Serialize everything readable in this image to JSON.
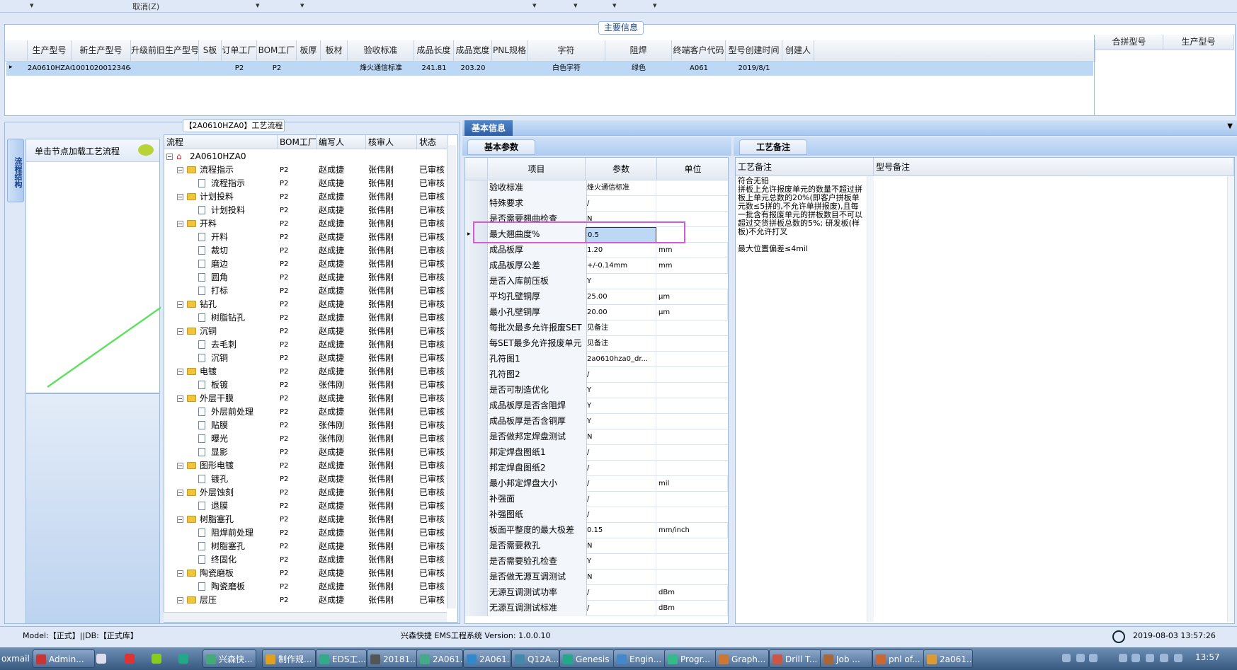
{
  "topbar": {
    "cancel": "取消(Z)"
  },
  "main_info": {
    "title": "主要信息",
    "columns": [
      "生产型号",
      "新生产型号",
      "升级前旧生产型号",
      "S板",
      "订单工厂",
      "BOM工厂",
      "板厚",
      "板材",
      "验收标准",
      "成品长度",
      "成品宽度",
      "PNL规格",
      "字符",
      "阻焊",
      "终端客户代码",
      "型号创建时间",
      "创建人"
    ],
    "right_columns": [
      "合拼型号",
      "生产型号"
    ],
    "row": {
      "生产型号": "2A0610HZA0",
      "新生产型号": "10010200123464",
      "订单工厂": "P2",
      "BOM工厂": "P2",
      "验收标准": "烽火通信标准",
      "成品长度": "241.81",
      "成品宽度": "203.20",
      "字符": "白色字符",
      "阻焊": "绿色",
      "终端客户代码": "A061",
      "型号创建时间": "2019/8/1"
    }
  },
  "left": {
    "tab_title": "【2A0610HZA0】工艺流程",
    "vtab": "流程结构",
    "nav_item": "单击节点加载工艺流程",
    "tree_headers": [
      "流程",
      "BOM工厂",
      "编写人",
      "核审人",
      "状态"
    ],
    "root": "2A0610HZA0",
    "rows": [
      {
        "name": "流程指示",
        "lvl": 1,
        "bom": "P2",
        "w": "赵成捷",
        "r": "张伟刚",
        "s": "已审核"
      },
      {
        "name": "流程指示",
        "lvl": 2,
        "bom": "P2",
        "w": "赵成捷",
        "r": "张伟刚",
        "s": "已审核"
      },
      {
        "name": "计划投料",
        "lvl": 1,
        "bom": "P2",
        "w": "赵成捷",
        "r": "张伟刚",
        "s": "已审核"
      },
      {
        "name": "计划投料",
        "lvl": 2,
        "bom": "P2",
        "w": "赵成捷",
        "r": "张伟刚",
        "s": "已审核"
      },
      {
        "name": "开料",
        "lvl": 1,
        "bom": "P2",
        "w": "赵成捷",
        "r": "张伟刚",
        "s": "已审核"
      },
      {
        "name": "开料",
        "lvl": 2,
        "bom": "P2",
        "w": "赵成捷",
        "r": "张伟刚",
        "s": "已审核"
      },
      {
        "name": "裁切",
        "lvl": 2,
        "bom": "P2",
        "w": "赵成捷",
        "r": "张伟刚",
        "s": "已审核"
      },
      {
        "name": "磨边",
        "lvl": 2,
        "bom": "P2",
        "w": "赵成捷",
        "r": "张伟刚",
        "s": "已审核"
      },
      {
        "name": "圆角",
        "lvl": 2,
        "bom": "P2",
        "w": "赵成捷",
        "r": "张伟刚",
        "s": "已审核"
      },
      {
        "name": "打标",
        "lvl": 2,
        "bom": "P2",
        "w": "赵成捷",
        "r": "张伟刚",
        "s": "已审核"
      },
      {
        "name": "钻孔",
        "lvl": 1,
        "bom": "P2",
        "w": "赵成捷",
        "r": "张伟刚",
        "s": "已审核"
      },
      {
        "name": "树脂钻孔",
        "lvl": 2,
        "bom": "P2",
        "w": "赵成捷",
        "r": "张伟刚",
        "s": "已审核"
      },
      {
        "name": "沉铜",
        "lvl": 1,
        "bom": "P2",
        "w": "赵成捷",
        "r": "张伟刚",
        "s": "已审核"
      },
      {
        "name": "去毛刺",
        "lvl": 2,
        "bom": "P2",
        "w": "赵成捷",
        "r": "张伟刚",
        "s": "已审核"
      },
      {
        "name": "沉铜",
        "lvl": 2,
        "bom": "P2",
        "w": "赵成捷",
        "r": "张伟刚",
        "s": "已审核"
      },
      {
        "name": "电镀",
        "lvl": 1,
        "bom": "P2",
        "w": "赵成捷",
        "r": "张伟刚",
        "s": "已审核"
      },
      {
        "name": "板镀",
        "lvl": 2,
        "bom": "P2",
        "w": "张伟刚",
        "r": "张伟刚",
        "s": "已审核"
      },
      {
        "name": "外层干膜",
        "lvl": 1,
        "bom": "P2",
        "w": "赵成捷",
        "r": "张伟刚",
        "s": "已审核"
      },
      {
        "name": "外层前处理",
        "lvl": 2,
        "bom": "P2",
        "w": "赵成捷",
        "r": "张伟刚",
        "s": "已审核"
      },
      {
        "name": "贴膜",
        "lvl": 2,
        "bom": "P2",
        "w": "张伟刚",
        "r": "张伟刚",
        "s": "已审核"
      },
      {
        "name": "曝光",
        "lvl": 2,
        "bom": "P2",
        "w": "张伟刚",
        "r": "张伟刚",
        "s": "已审核"
      },
      {
        "name": "显影",
        "lvl": 2,
        "bom": "P2",
        "w": "赵成捷",
        "r": "张伟刚",
        "s": "已审核"
      },
      {
        "name": "图形电镀",
        "lvl": 1,
        "bom": "P2",
        "w": "赵成捷",
        "r": "张伟刚",
        "s": "已审核"
      },
      {
        "name": "镀孔",
        "lvl": 2,
        "bom": "P2",
        "w": "赵成捷",
        "r": "张伟刚",
        "s": "已审核"
      },
      {
        "name": "外层蚀刻",
        "lvl": 1,
        "bom": "P2",
        "w": "赵成捷",
        "r": "张伟刚",
        "s": "已审核"
      },
      {
        "name": "退膜",
        "lvl": 2,
        "bom": "P2",
        "w": "赵成捷",
        "r": "张伟刚",
        "s": "已审核"
      },
      {
        "name": "树脂塞孔",
        "lvl": 1,
        "bom": "P2",
        "w": "赵成捷",
        "r": "张伟刚",
        "s": "已审核"
      },
      {
        "name": "阻焊前处理",
        "lvl": 2,
        "bom": "P2",
        "w": "赵成捷",
        "r": "张伟刚",
        "s": "已审核"
      },
      {
        "name": "树脂塞孔",
        "lvl": 2,
        "bom": "P2",
        "w": "赵成捷",
        "r": "张伟刚",
        "s": "已审核"
      },
      {
        "name": "终固化",
        "lvl": 2,
        "bom": "P2",
        "w": "赵成捷",
        "r": "张伟刚",
        "s": "已审核"
      },
      {
        "name": "陶瓷磨板",
        "lvl": 1,
        "bom": "P2",
        "w": "赵成捷",
        "r": "张伟刚",
        "s": "已审核"
      },
      {
        "name": "陶瓷磨板",
        "lvl": 2,
        "bom": "P2",
        "w": "赵成捷",
        "r": "张伟刚",
        "s": "已审核"
      },
      {
        "name": "层压",
        "lvl": 1,
        "bom": "P2",
        "w": "赵成捷",
        "r": "张伟刚",
        "s": "已审核"
      }
    ]
  },
  "middle": {
    "tab": "基本信息",
    "subtab": "基本参数",
    "headers": [
      "项目",
      "参数",
      "单位"
    ],
    "rows": [
      {
        "n": "验收标准",
        "v": "烽火通信标准",
        "u": ""
      },
      {
        "n": "特殊要求",
        "v": "/",
        "u": ""
      },
      {
        "n": "是否需要翘曲检查",
        "v": "N",
        "u": ""
      },
      {
        "n": "最大翘曲度%",
        "v": "0.5",
        "u": ""
      },
      {
        "n": "成品板厚",
        "v": "1.20",
        "u": "mm"
      },
      {
        "n": "成品板厚公差",
        "v": "+/-0.14mm",
        "u": "mm"
      },
      {
        "n": "是否入库前压板",
        "v": "Y",
        "u": ""
      },
      {
        "n": "平均孔壁铜厚",
        "v": "25.00",
        "u": "μm"
      },
      {
        "n": "最小孔壁铜厚",
        "v": "20.00",
        "u": "μm"
      },
      {
        "n": "每批次最多允许报废SET",
        "v": "见备注",
        "u": ""
      },
      {
        "n": "每SET最多允许报废单元",
        "v": "见备注",
        "u": ""
      },
      {
        "n": "孔符图1",
        "v": "2a0610hza0_dr...",
        "u": ""
      },
      {
        "n": "孔符图2",
        "v": "/",
        "u": ""
      },
      {
        "n": "是否可制造优化",
        "v": "Y",
        "u": ""
      },
      {
        "n": "成品板厚是否含阻焊",
        "v": "Y",
        "u": ""
      },
      {
        "n": "成品板厚是否含铜厚",
        "v": "Y",
        "u": ""
      },
      {
        "n": "是否做邦定焊盘测试",
        "v": "N",
        "u": ""
      },
      {
        "n": "邦定焊盘图纸1",
        "v": "/",
        "u": ""
      },
      {
        "n": "邦定焊盘图纸2",
        "v": "/",
        "u": ""
      },
      {
        "n": "最小邦定焊盘大小",
        "v": "/",
        "u": "mil"
      },
      {
        "n": "补强面",
        "v": "/",
        "u": ""
      },
      {
        "n": "补强图纸",
        "v": "/",
        "u": ""
      },
      {
        "n": "板面平整度的最大极差",
        "v": "0.15",
        "u": "mm/inch"
      },
      {
        "n": "是否需要救孔",
        "v": "N",
        "u": ""
      },
      {
        "n": "是否需要验孔检查",
        "v": "Y",
        "u": ""
      },
      {
        "n": "是否做无源互调测试",
        "v": "N",
        "u": ""
      },
      {
        "n": "无源互调测试功率",
        "v": "/",
        "u": "dBm"
      },
      {
        "n": "无源互调测试标准",
        "v": "/",
        "u": "dBm"
      }
    ]
  },
  "right": {
    "subtab": "工艺备注",
    "headers": [
      "工艺备注",
      "型号备注"
    ],
    "note": "符合无铅\n拼板上允许报废单元的数量不超过拼板上单元总数的20%(即客户拼板单元数≤5拼的,不允许单拼报废),且每一批含有报废单元的拼板数目不可以超过交货拼板总数的5%; 研发板(样板)不允许打叉\n\n最大位置偏差≤4mil"
  },
  "status": {
    "left": "Model:【正式】||DB:【正式库】",
    "center": "兴森快捷 EMS工程系统 Version: 1.0.0.10",
    "datetime": "2019-08-03 13:57:26"
  },
  "taskbar": {
    "items": [
      "oxmail",
      "Admin...",
      "兴森快...",
      "制作规...",
      "EDS工...",
      "20181...",
      "2A061...",
      "2A061...",
      "Q12A...",
      "Genesis",
      "Engin...",
      "Progr...",
      "Graph...",
      "Drill T...",
      "Job ...",
      "pnl of...",
      "2a061..."
    ],
    "clock": "13:57"
  }
}
